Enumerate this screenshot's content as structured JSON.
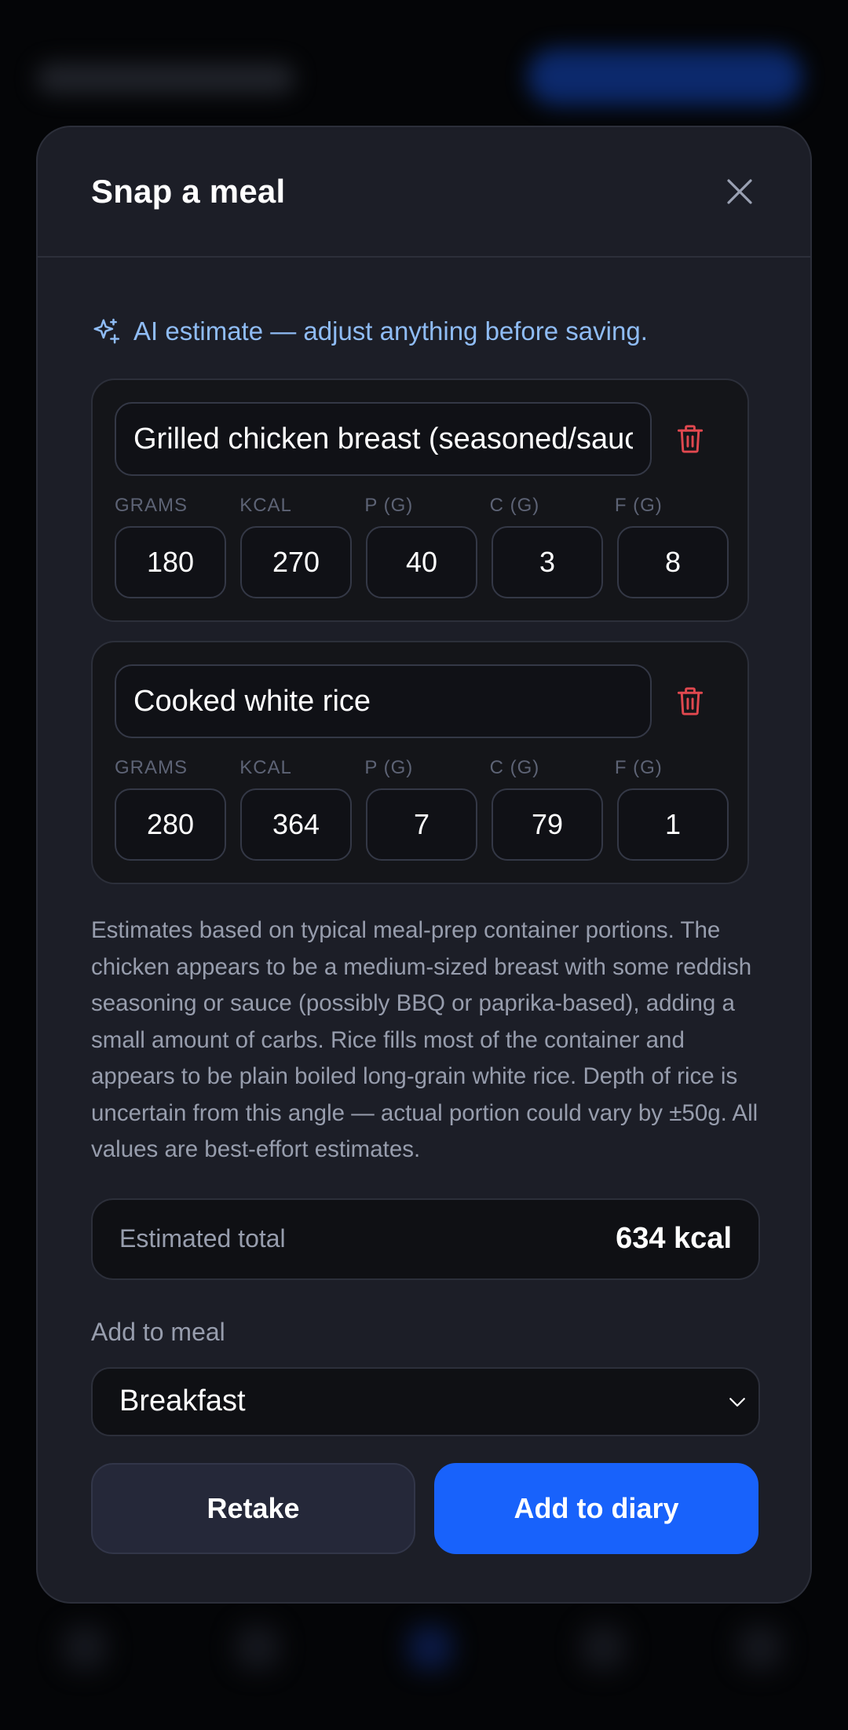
{
  "modal": {
    "title": "Snap a meal",
    "close_icon": "close-icon"
  },
  "ai_note": {
    "icon": "sparkles-icon",
    "text": "AI estimate — adjust anything before saving."
  },
  "macro_headers": {
    "grams": "GRAMS",
    "kcal": "KCAL",
    "protein": "P (G)",
    "carbs": "C (G)",
    "fat": "F (G)"
  },
  "items": [
    {
      "name": "Grilled chicken breast (seasoned/sauced)",
      "grams": "180",
      "kcal": "270",
      "protein": "40",
      "carbs": "3",
      "fat": "8"
    },
    {
      "name": "Cooked white rice",
      "grams": "280",
      "kcal": "364",
      "protein": "7",
      "carbs": "79",
      "fat": "1"
    }
  ],
  "notes": "Estimates based on typical meal-prep container portions. The chicken appears to be a medium-sized breast with some reddish seasoning or sauce (possibly BBQ or paprika-based), adding a small amount of carbs. Rice fills most of the container and appears to be plain boiled long-grain white rice. Depth of rice is uncertain from this angle — actual portion could vary by ±50g. All values are best-effort estimates.",
  "total": {
    "label": "Estimated total",
    "value": "634 kcal"
  },
  "meal": {
    "label": "Add to meal",
    "selected": "Breakfast"
  },
  "actions": {
    "retake": "Retake",
    "add": "Add to diary"
  },
  "colors": {
    "accent": "#1862fb",
    "ai_text": "#8fbcf5",
    "danger": "#e0484f",
    "modal_bg": "#1c1e27"
  }
}
